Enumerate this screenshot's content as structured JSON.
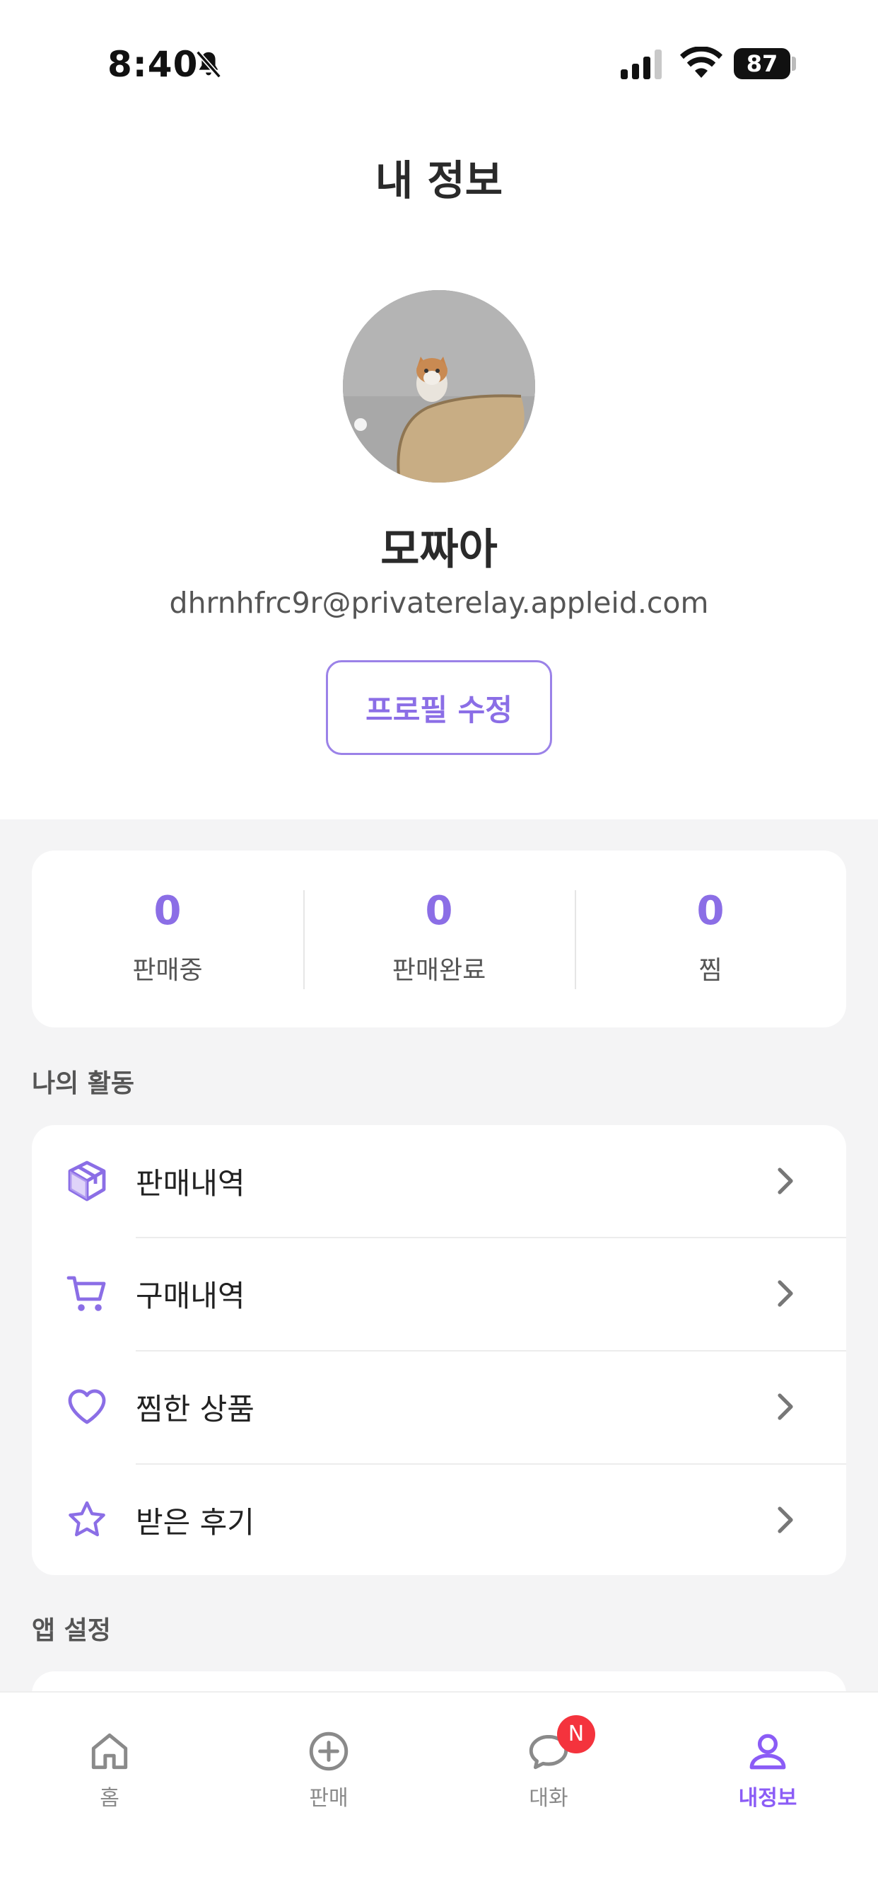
{
  "status_bar": {
    "time": "8:40",
    "battery": "87"
  },
  "header": {
    "title": "내 정보"
  },
  "profile": {
    "name": "모짜아",
    "email": "dhrnhfrc9r@privaterelay.appleid.com",
    "edit_button": "프로필 수정"
  },
  "stats": [
    {
      "value": "0",
      "label": "판매중"
    },
    {
      "value": "0",
      "label": "판매완료"
    },
    {
      "value": "0",
      "label": "찜"
    }
  ],
  "activity": {
    "title": "나의 활동",
    "items": [
      {
        "label": "판매내역",
        "icon": "box-icon"
      },
      {
        "label": "구매내역",
        "icon": "cart-icon"
      },
      {
        "label": "찜한 상품",
        "icon": "heart-icon"
      },
      {
        "label": "받은 후기",
        "icon": "star-icon"
      }
    ]
  },
  "settings": {
    "title": "앱 설정"
  },
  "tabs": [
    {
      "label": "홈",
      "icon": "home-icon"
    },
    {
      "label": "판매",
      "icon": "plus-circle-icon"
    },
    {
      "label": "대화",
      "icon": "chat-icon",
      "badge": "N"
    },
    {
      "label": "내정보",
      "icon": "user-icon",
      "active": true
    }
  ],
  "colors": {
    "accent": "#8b6ee6",
    "badge": "#f4333d",
    "background": "#f4f4f5"
  }
}
